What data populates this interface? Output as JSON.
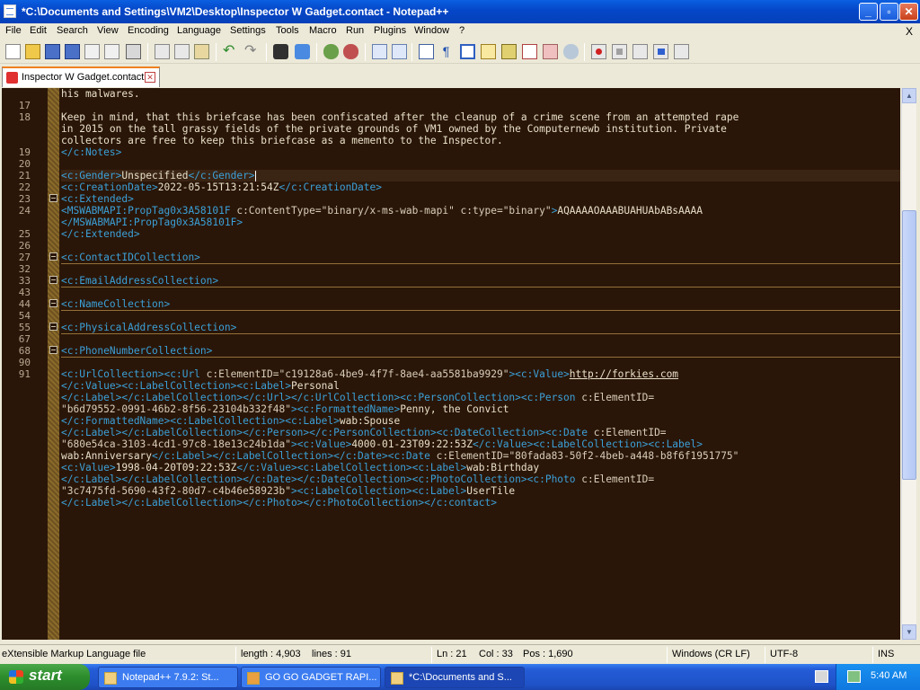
{
  "window": {
    "title": "*C:\\Documents and Settings\\VM2\\Desktop\\Inspector W Gadget.contact - Notepad++"
  },
  "menu": {
    "items": [
      "File",
      "Edit",
      "Search",
      "View",
      "Encoding",
      "Language",
      "Settings",
      "Tools",
      "Macro",
      "Run",
      "Plugins",
      "Window",
      "?"
    ],
    "close": "X"
  },
  "toolbar_icons": [
    "new-file-icon",
    "open-file-icon",
    "save-icon",
    "save-all-icon",
    "close-icon",
    "close-all-icon",
    "print-icon",
    "cut-icon",
    "copy-icon",
    "paste-icon",
    "undo-icon",
    "redo-icon",
    "find-icon",
    "replace-icon",
    "zoom-in-icon",
    "zoom-out-icon",
    "sync-v-icon",
    "sync-h-icon",
    "word-wrap-icon",
    "show-all-chars-icon",
    "indent-guide-icon",
    "udl-icon",
    "doc-map-icon",
    "function-list-icon",
    "folder-workspace-icon",
    "monitor-icon",
    "record-macro-icon",
    "stop-record-icon",
    "play-macro-icon",
    "run-macro-multiple-icon",
    "save-macro-icon"
  ],
  "tab": {
    "label": "Inspector W Gadget.contact"
  },
  "editor": {
    "line_numbers": [
      "17",
      "18",
      "19",
      "20",
      "21",
      "22",
      "23",
      "24",
      "25",
      "26",
      "27",
      "32",
      "33",
      "43",
      "44",
      "54",
      "55",
      "67",
      "68",
      "90",
      "91"
    ],
    "l_top": "his malwares.",
    "l18a": "Keep in mind, that this briefcase has been confiscated after the cleanup of a crime scene from an attempted rape",
    "l18b": "in 2015 on the tall grassy fields of the private grounds of VM1 owned by the Computernewb institution. Private",
    "l18c": "collectors are free to keep this briefcase as a memento to the Inspector.",
    "l19": "</c:Notes>",
    "l21_open": "<c:Gender>",
    "l21_val": "Unspecified",
    "l21_close": "</c:Gender>",
    "l22_open": "<c:CreationDate>",
    "l22_val": "2022-05-15T13:21:54Z",
    "l22_close": "</c:CreationDate>",
    "l23": "<c:Extended>",
    "l24_tag": "<MSWABMAPI:PropTag0x3A58101F",
    "l24_attr": " c:ContentType=\"binary/x-ms-wab-mapi\" c:type=\"binary\"",
    "l24_gt": ">",
    "l24_val": "AQAAAAOAAABUAHUAbABsAAAA",
    "l24b": "</MSWABMAPI:PropTag0x3A58101F>",
    "l25": "</c:Extended>",
    "l27": "<c:ContactIDCollection>",
    "l33": "<c:EmailAddressCollection>",
    "l44": "<c:NameCollection>",
    "l55": "<c:PhysicalAddressCollection>",
    "l68": "<c:PhoneNumberCollection>",
    "l91a_t1": "<c:UrlCollection><c:Url",
    "l91a_a1": " c:ElementID=\"c19128a6-4be9-4f7f-8ae4-aa5581ba9929\"",
    "l91a_t2": "><c:Value>",
    "l91a_url": "http://forkies.com",
    "l91b_t1": "</c:Value><c:LabelCollection><c:Label>",
    "l91b_v": "Personal",
    "l91c_t1": "</c:Label></c:LabelCollection></c:Url></c:UrlCollection><c:PersonCollection><c:Person",
    "l91c_a": " c:ElementID=",
    "l91d_v": "\"b6d79552-0991-46b2-8f56-23104b332f48\"",
    "l91d_t": "><c:FormattedName>",
    "l91d_v2": "Penny, the Convict",
    "l91e_t": "</c:FormattedName><c:LabelCollection><c:Label>",
    "l91e_v": "wab:Spouse",
    "l91f_t": "</c:Label></c:LabelCollection></c:Person></c:PersonCollection><c:DateCollection><c:Date",
    "l91f_a": " c:ElementID=",
    "l91g_v": "\"680e54ca-3103-4cd1-97c8-18e13c24b1da\"",
    "l91g_t": "><c:Value>",
    "l91g_v2": "4000-01-23T09:22:53Z",
    "l91g_t2": "</c:Value><c:LabelCollection><c:Label>",
    "l91h_v": "wab:Anniversary",
    "l91h_t": "</c:Label></c:LabelCollection></c:Date><c:Date",
    "l91h_a": " c:ElementID=\"80fada83-50f2-4beb-a448-b8f6f1951775\"",
    "l91i_t": "<c:Value>",
    "l91i_v": "1998-04-20T09:22:53Z",
    "l91i_t2": "</c:Value><c:LabelCollection><c:Label>",
    "l91i_v2": "wab:Birthday",
    "l91j_t": "</c:Label></c:LabelCollection></c:Date></c:DateCollection><c:PhotoCollection><c:Photo",
    "l91j_a": " c:ElementID=",
    "l91k_v": "\"3c7475fd-5690-43f2-80d7-c4b46e58923b\"",
    "l91k_t": "><c:LabelCollection><c:Label>",
    "l91k_v2": "UserTile",
    "l91l": "</c:Label></c:LabelCollection></c:Photo></c:PhotoCollection></c:contact>"
  },
  "status": {
    "type": "eXtensible Markup Language file",
    "length": "length : 4,903",
    "lines": "lines : 91",
    "ln": "Ln : 21",
    "col": "Col : 33",
    "pos": "Pos : 1,690",
    "eol": "Windows (CR LF)",
    "encoding": "UTF-8",
    "mode": "INS"
  },
  "taskbar": {
    "start": "start",
    "tasks": [
      "Notepad++ 7.9.2: St...",
      "GO GO GADGET RAPI...",
      "*C:\\Documents and S..."
    ],
    "time": "5:40 AM"
  }
}
